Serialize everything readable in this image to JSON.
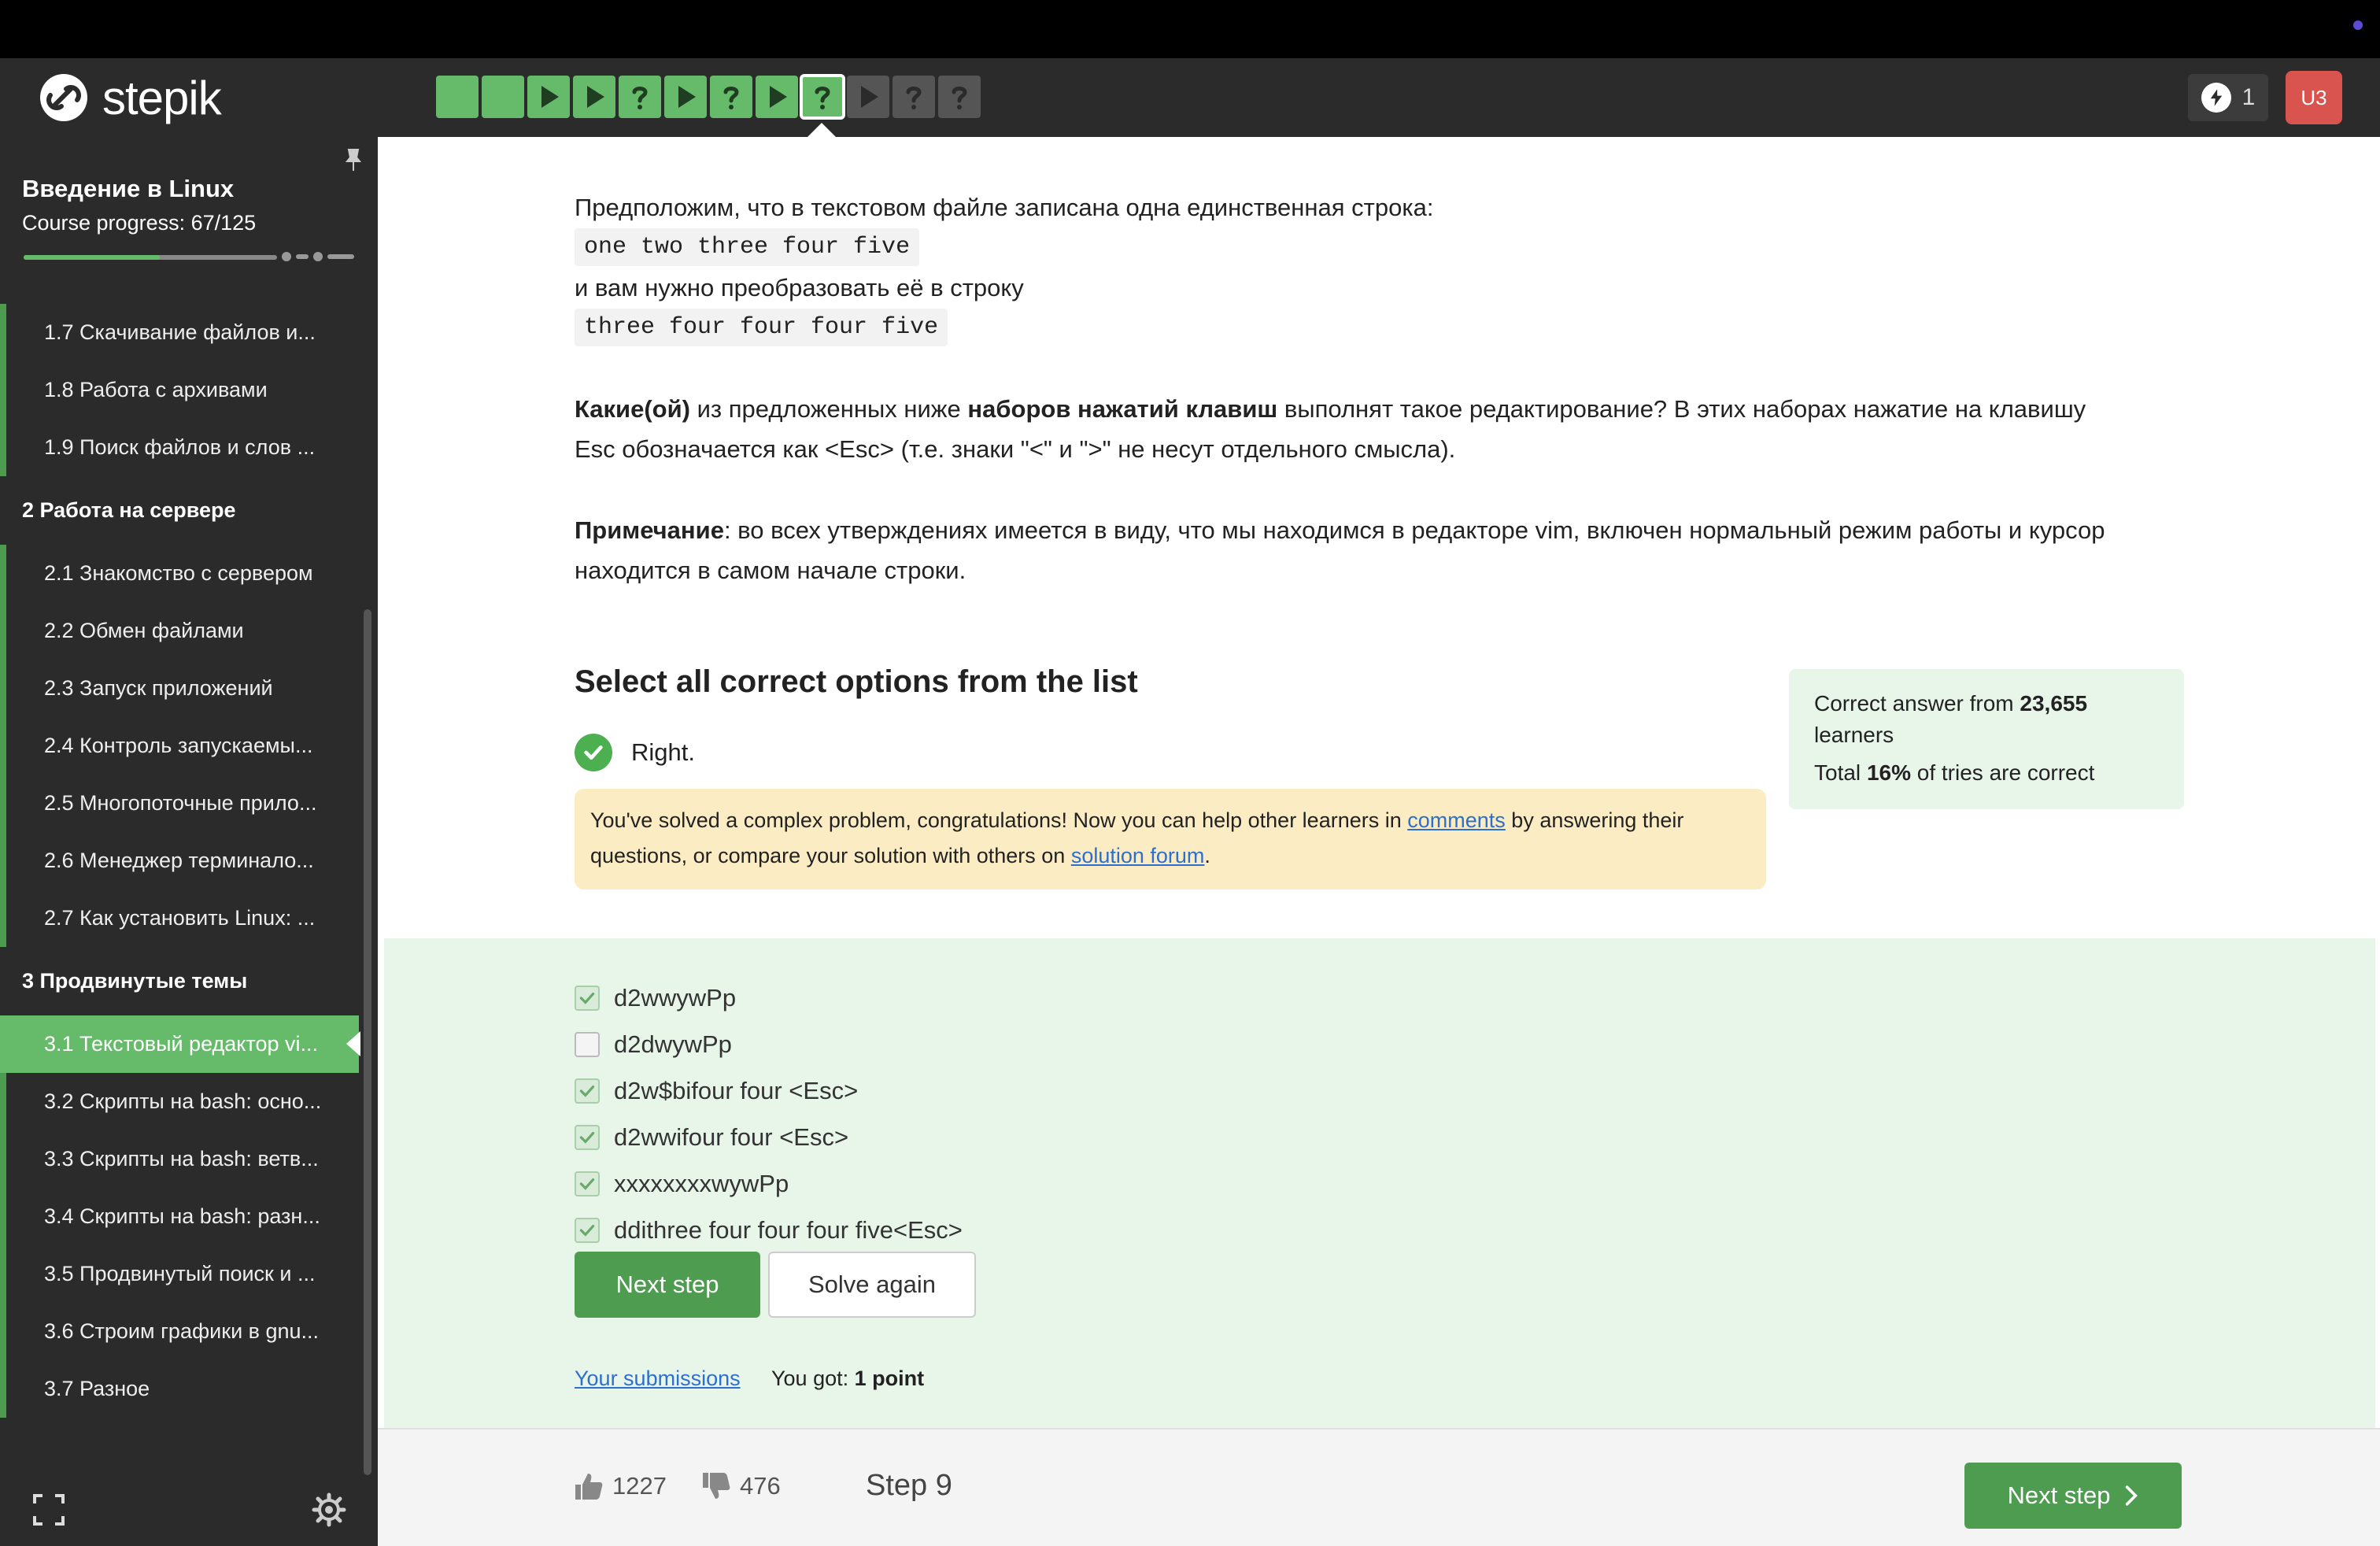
{
  "header": {
    "logo_text": "stepik",
    "steps": [
      {
        "kind": "done",
        "glyph": ""
      },
      {
        "kind": "done",
        "glyph": ""
      },
      {
        "kind": "done",
        "glyph": "play"
      },
      {
        "kind": "done",
        "glyph": "play"
      },
      {
        "kind": "done",
        "glyph": "?"
      },
      {
        "kind": "done",
        "glyph": "play"
      },
      {
        "kind": "done",
        "glyph": "?"
      },
      {
        "kind": "done",
        "glyph": "play"
      },
      {
        "kind": "current",
        "glyph": "?"
      },
      {
        "kind": "todo",
        "glyph": "play"
      },
      {
        "kind": "todo",
        "glyph": "?"
      },
      {
        "kind": "todo",
        "glyph": "?"
      }
    ],
    "streak_count": "1",
    "avatar_initials": "U3",
    "colors": {
      "done": "#66bb6a",
      "todo": "#555555",
      "avatar": "#d9534f"
    }
  },
  "sidebar": {
    "course_title": "Введение в Linux",
    "course_progress": "Course progress:  67/125",
    "progress_fraction": 0.536,
    "items": [
      {
        "type": "lesson",
        "label": "1.7  Скачивание файлов и..."
      },
      {
        "type": "lesson",
        "label": "1.8  Работа с архивами"
      },
      {
        "type": "lesson",
        "label": "1.9  Поиск файлов и слов ..."
      },
      {
        "type": "section",
        "label": "2  Работа на сервере"
      },
      {
        "type": "lesson",
        "label": "2.1  Знакомство с сервером"
      },
      {
        "type": "lesson",
        "label": "2.2  Обмен файлами"
      },
      {
        "type": "lesson",
        "label": "2.3  Запуск приложений"
      },
      {
        "type": "lesson",
        "label": "2.4  Контроль запускаемы..."
      },
      {
        "type": "lesson",
        "label": "2.5  Многопоточные прило..."
      },
      {
        "type": "lesson",
        "label": "2.6  Менеджер терминало..."
      },
      {
        "type": "lesson",
        "label": "2.7  Как установить Linux: ..."
      },
      {
        "type": "section",
        "label": "3  Продвинутые темы"
      },
      {
        "type": "lesson",
        "label": "3.1  Текстовый редактор vi...",
        "active": true
      },
      {
        "type": "lesson",
        "label": "3.2  Скрипты на bash: осно..."
      },
      {
        "type": "lesson",
        "label": "3.3  Скрипты на bash: ветв..."
      },
      {
        "type": "lesson",
        "label": "3.4  Скрипты на bash: разн..."
      },
      {
        "type": "lesson",
        "label": "3.5  Продвинутый поиск и ..."
      },
      {
        "type": "lesson",
        "label": "3.6  Строим графики в gnu..."
      },
      {
        "type": "lesson",
        "label": "3.7  Разное"
      }
    ]
  },
  "main": {
    "p1": "Предположим, что в текстовом файле записана одна единственная строка:",
    "code1": "one two three four five",
    "p2": "и вам нужно преобразовать её в строку",
    "code2": "three four four four five",
    "p3_bold1": "Какие(ой)",
    "p3_mid1": " из предложенных ниже ",
    "p3_bold2": "наборов нажатий клавиш",
    "p3_rest": " выполнят такое редактирование? В этих наборах нажатие на клавишу",
    "p3_line2": "Esc обозначается как <Esc> (т.е. знаки \"<\" и \">\" не несут отдельного смысла).",
    "p4_bold": "Примечание",
    "p4_rest": ": во всех утверждениях имеется в виду, что мы находимся в редакторе vim, включен нормальный режим работы и курсор",
    "p4_line2": "находится в самом начале строки.",
    "question_title": "Select all correct options from the list",
    "stats_prefix": "Correct answer from ",
    "stats_learners": "23,655",
    "stats_learners_suffix": "learners",
    "stats_total_prefix": "Total ",
    "stats_percent": "16%",
    "stats_total_suffix": " of tries are correct",
    "right_label": "Right.",
    "congrats_1": "You've solved a complex problem, congratulations! Now you can help other learners in ",
    "congrats_link1": "comments",
    "congrats_2": " by answering their",
    "congrats_3": "questions, or compare your solution with others on ",
    "congrats_link2": "solution forum",
    "congrats_4": ".",
    "options": [
      {
        "label": "d2wwywPp",
        "checked": true
      },
      {
        "label": "d2dwywPp",
        "checked": false
      },
      {
        "label": "d2w$bifour four <Esc>",
        "checked": true
      },
      {
        "label": "d2wwifour four <Esc>",
        "checked": true
      },
      {
        "label": "xxxxxxxxwywPp",
        "checked": true
      },
      {
        "label": "ddithree four four four five<Esc>",
        "checked": true
      }
    ],
    "next_step_label": "Next step",
    "solve_again_label": "Solve again",
    "submissions_link": "Your submissions",
    "you_got_prefix": "You got: ",
    "you_got_points": "1 point"
  },
  "footer": {
    "likes": "1227",
    "dislikes": "476",
    "step_label": "Step 9",
    "next_step_label": "Next step"
  }
}
